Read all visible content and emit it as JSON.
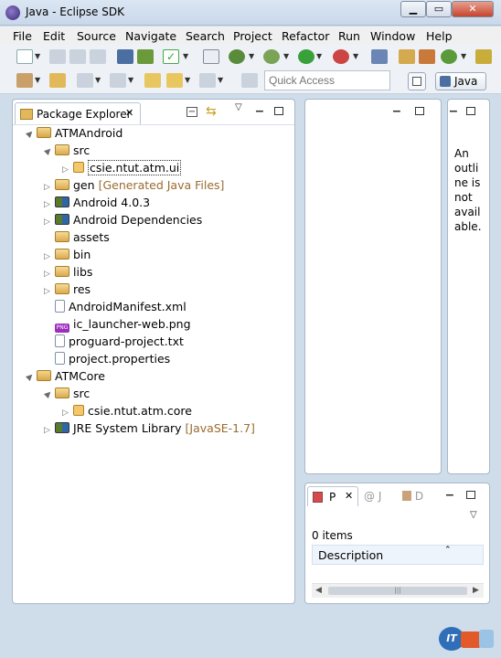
{
  "window": {
    "title": "Java - Eclipse SDK",
    "buttons": [
      "▁",
      "▭",
      "✕"
    ]
  },
  "menu": [
    "File",
    "Edit",
    "Source",
    "Navigate",
    "Search",
    "Project",
    "Refactor",
    "Run",
    "Window",
    "Help"
  ],
  "toolbar": {
    "quick_access_placeholder": "Quick Access",
    "perspective_label": "Java"
  },
  "package_explorer": {
    "tab_label": "Package Explorer",
    "tree": [
      {
        "label": "ATMAndroid",
        "decoration": "",
        "icon": "project-icon",
        "arrow": "▲",
        "indent": 0
      },
      {
        "label": "src",
        "decoration": "",
        "icon": "source-folder-icon",
        "arrow": "▲",
        "indent": 1
      },
      {
        "label": "csie.ntut.atm.ui",
        "decoration": "",
        "icon": "package-icon",
        "arrow": "▷",
        "indent": 2,
        "selected": true
      },
      {
        "label": "gen",
        "decoration": "[Generated Java Files]",
        "icon": "source-folder-icon",
        "arrow": "▷",
        "indent": 1
      },
      {
        "label": "Android 4.0.3",
        "decoration": "",
        "icon": "library-icon",
        "arrow": "▷",
        "indent": 1
      },
      {
        "label": "Android Dependencies",
        "decoration": "",
        "icon": "library-icon",
        "arrow": "▷",
        "indent": 1
      },
      {
        "label": "assets",
        "decoration": "",
        "icon": "folder-icon",
        "arrow": "",
        "indent": 1
      },
      {
        "label": "bin",
        "decoration": "",
        "icon": "folder-icon",
        "arrow": "▷",
        "indent": 1
      },
      {
        "label": "libs",
        "decoration": "",
        "icon": "folder-icon",
        "arrow": "▷",
        "indent": 1
      },
      {
        "label": "res",
        "decoration": "",
        "icon": "folder-icon",
        "arrow": "▷",
        "indent": 1
      },
      {
        "label": "AndroidManifest.xml",
        "decoration": "",
        "icon": "xml-file-icon",
        "arrow": "",
        "indent": 1
      },
      {
        "label": "ic_launcher-web.png",
        "decoration": "",
        "icon": "png-file-icon",
        "arrow": "",
        "indent": 1
      },
      {
        "label": "proguard-project.txt",
        "decoration": "",
        "icon": "text-file-icon",
        "arrow": "",
        "indent": 1
      },
      {
        "label": "project.properties",
        "decoration": "",
        "icon": "properties-file-icon",
        "arrow": "",
        "indent": 1
      },
      {
        "label": "ATMCore",
        "decoration": "",
        "icon": "project-icon",
        "arrow": "▲",
        "indent": 0
      },
      {
        "label": "src",
        "decoration": "",
        "icon": "source-folder-icon",
        "arrow": "▲",
        "indent": 1
      },
      {
        "label": "csie.ntut.atm.core",
        "decoration": "",
        "icon": "package-icon",
        "arrow": "▷",
        "indent": 2
      },
      {
        "label": "JRE System Library",
        "decoration": "[JavaSE-1.7]",
        "icon": "library-icon",
        "arrow": "▷",
        "indent": 1
      }
    ]
  },
  "outline": {
    "message_lines": [
      "An",
      "outli",
      "ne is",
      "not",
      "avail",
      "able."
    ]
  },
  "problems": {
    "tabs": [
      {
        "label": "P",
        "active": true
      },
      {
        "label": "J",
        "active": false
      },
      {
        "label": "D",
        "active": false
      }
    ],
    "count": "0 items",
    "column": "Description"
  }
}
